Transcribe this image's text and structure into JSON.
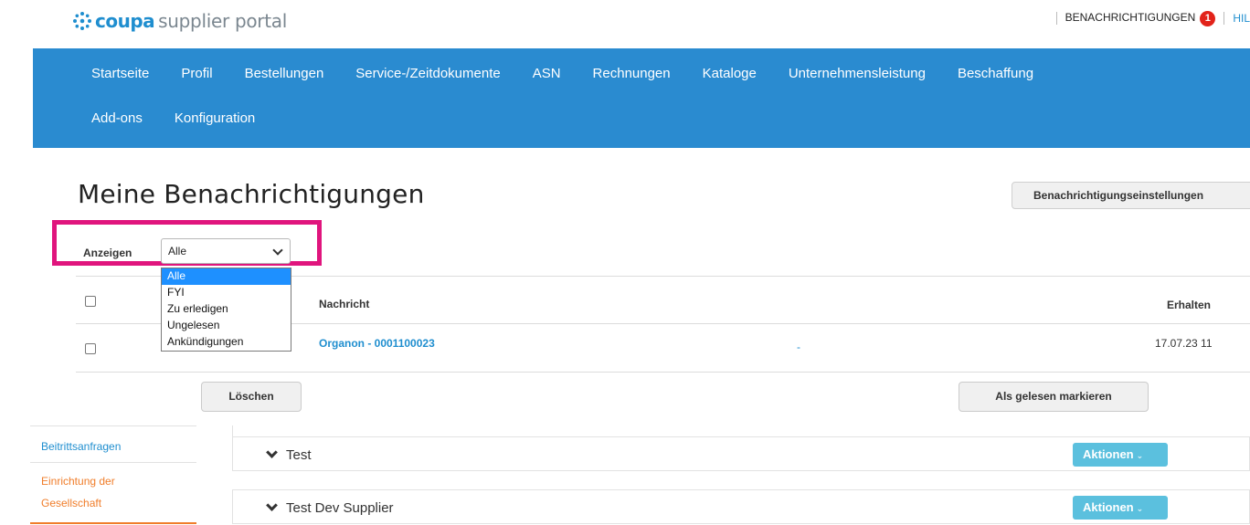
{
  "header": {
    "logo_brand": "coupa",
    "logo_rest": "supplier portal",
    "notifications_label": "BENACHRICHTIGUNGEN",
    "notifications_count": "1",
    "help_label": "HIL"
  },
  "nav": {
    "row1": [
      "Startseite",
      "Profil",
      "Bestellungen",
      "Service-/Zeitdokumente",
      "ASN",
      "Rechnungen",
      "Kataloge",
      "Unternehmensleistung",
      "Beschaffung"
    ],
    "row2": [
      "Add-ons",
      "Konfiguration"
    ]
  },
  "page": {
    "title": "Meine Benachrichtigungen",
    "settings_button": "Benachrichtigungseinstellungen"
  },
  "filter": {
    "label": "Anzeigen",
    "selected": "Alle",
    "options": [
      "Alle",
      "FYI",
      "Zu erledigen",
      "Ungelesen",
      "Ankündigungen"
    ]
  },
  "table": {
    "headers": {
      "message": "Nachricht",
      "received": "Erhalten"
    },
    "rows": [
      {
        "message": "Organon - 0001100023",
        "extra": "-",
        "received": "17.07.23 11"
      }
    ]
  },
  "actions": {
    "delete": "Löschen",
    "mark_read": "Als gelesen markieren"
  },
  "sidebar": {
    "items": [
      "Beitrittsanfragen",
      "Einrichtung der",
      "Gesellschaft"
    ]
  },
  "panels": [
    {
      "title": "Test",
      "action": "Aktionen"
    },
    {
      "title": "Test Dev Supplier",
      "action": "Aktionen"
    }
  ],
  "colors": {
    "brand_blue": "#2a8bd0",
    "highlight": "#e0157d",
    "badge_red": "#e2231a",
    "link_blue": "#1f8ecf",
    "sidebar_orange": "#f07d2a",
    "actions_cyan": "#5bc0de"
  }
}
